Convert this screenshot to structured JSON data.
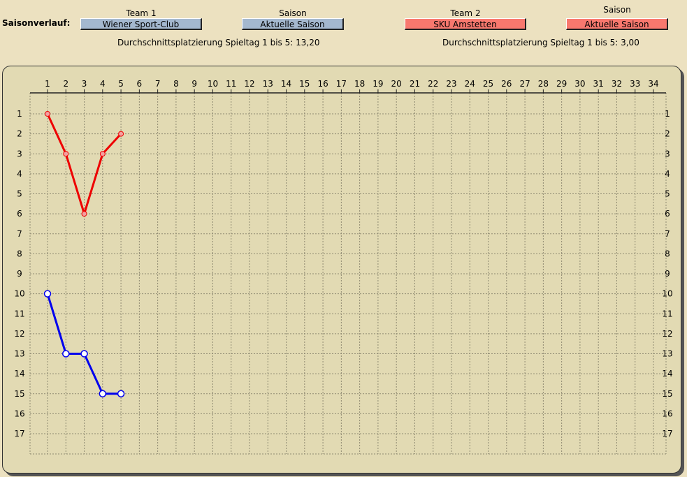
{
  "header": {
    "label": "Saisonverlauf:",
    "team1_title": "Team 1",
    "season1_title": "Saison",
    "team2_title": "Team 2",
    "season2_title": "Saison",
    "team1_value": "Wiener Sport-Club",
    "season1_value": "Aktuelle Saison",
    "team2_value": "SKU Amstetten",
    "season2_value": "Aktuelle Saison",
    "avg1": "Durchschnittsplatzierung Spieltag 1 bis 5: 13,20",
    "avg2": "Durchschnittsplatzierung Spieltag 1 bis 5:  3,00"
  },
  "colors": {
    "team1": "#0000ee",
    "team2": "#ee0000",
    "team1_button": "#a4b8cf",
    "team2_button": "#f8786e",
    "background": "#ece1c0",
    "panel": "#e2dab3"
  },
  "chart_data": {
    "type": "line",
    "title": "",
    "xlabel": "",
    "ylabel": "",
    "x_ticks": [
      1,
      2,
      3,
      4,
      5,
      6,
      7,
      8,
      9,
      10,
      11,
      12,
      13,
      14,
      15,
      16,
      17,
      18,
      19,
      20,
      21,
      22,
      23,
      24,
      25,
      26,
      27,
      28,
      29,
      30,
      31,
      32,
      33,
      34
    ],
    "y_ticks": [
      1,
      2,
      3,
      4,
      5,
      6,
      7,
      8,
      9,
      10,
      11,
      12,
      13,
      14,
      15,
      16,
      17
    ],
    "xlim": [
      1,
      34
    ],
    "ylim": [
      1,
      17
    ],
    "y_inverted": true,
    "grid": true,
    "series": [
      {
        "name": "Wiener Sport-Club",
        "color": "#0000ee",
        "x": [
          1,
          2,
          3,
          4,
          5
        ],
        "y": [
          10,
          13,
          13,
          15,
          15
        ]
      },
      {
        "name": "SKU Amstetten",
        "color": "#ee0000",
        "x": [
          1,
          2,
          3,
          4,
          5
        ],
        "y": [
          1,
          3,
          6,
          3,
          2
        ]
      }
    ]
  }
}
